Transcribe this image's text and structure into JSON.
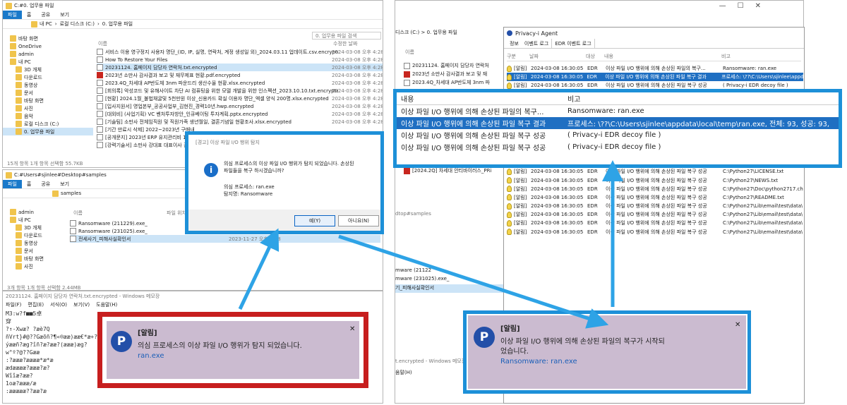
{
  "left_explorer": {
    "titlebar": "C:#0. 업무용 파일",
    "ribbon_tabs": [
      "파일",
      "홈",
      "공유",
      "보기"
    ],
    "address": [
      "내 PC",
      "로컬 디스크 (C:)",
      "0. 업무용 파일"
    ],
    "search_placeholder": "0. 업무용 파일 검색",
    "col_name": "이름",
    "col_date": "수정한 날짜",
    "nav": [
      "바탕 화면",
      "OneDrive",
      "admin",
      "내 PC",
      "3D 개체",
      "다운로드",
      "동영상",
      "문서",
      "바탕 화면",
      "사진",
      "음악",
      "로컬 디스크 (C:)",
      "0. 업무용 파일"
    ],
    "files": [
      {
        "name": "서비스 이용 영구정지 사용자 명단_(ID, IP, 실명, 연락처, 계정 생성일 외)_2024.03.11 업데이트.csv.encrypted",
        "date": "2024-03-08 오후 4:28"
      },
      {
        "name": "How To Restore Your Files",
        "date": "2024-03-08 오후 4:28"
      },
      {
        "name": "20231124. 홈페이지 담당자 연락처.txt.encrypted",
        "date": "2024-03-08 오후 4:28"
      },
      {
        "name": "2023년 소만사 감사결과 보고 및 재무제표 현황.pdf.encrypted",
        "date": "2024-03-08 오후 4:28"
      },
      {
        "name": "2023.4Q_차세대 AP반도체 3nm 파운드리 생산수율 현황.xlsx.encrypted",
        "date": "2024-03-08 오후 4:28"
      },
      {
        "name": "[회의록] 악성코드 및 유해사이트 차단 AI 컴퓨팅을 위한 모델 개발을 위한 인스펙션_2023.10.10.txt.encrypted",
        "date": "2024-03-08 오후 4:28"
      },
      {
        "name": "[현황] 2024.1월_불법채굴및 5천만원 이상_신용카드 확실 이용자 명단_엑셀 양식 200명.xlsx.encrypted",
        "date": "2024-03-08 오후 4:28"
      },
      {
        "name": "[입사지원서] 영업본부_공공사업부_김현진_경력10년.hwp.encrypted",
        "date": "2024-03-08 오후 4:28"
      },
      {
        "name": "[대외비] (사업기획) VC 벤처투자방안_인큐베이팅 투자계획.pptx.encrypted",
        "date": "2024-03-08 오후 4:28"
      },
      {
        "name": "[기술팀] 소만사 전체임직원 및 직원가족 생년월일, 결혼기념일 현황조사.xlsx.encrypted",
        "date": "2024-03-08 오후 4:28"
      },
      {
        "name": "[기간 만료시 삭제] 2022~2023년 구매내",
        "date": ""
      },
      {
        "name": "[공개문지] 2023년 ERP 유지관리비 1억",
        "date": ""
      },
      {
        "name": "[강력기술서] 소만사 강대표 대표이사 결",
        "date": ""
      }
    ],
    "status": "15개 항목   1개 항목 선택함 55.7KB"
  },
  "left_explorer2": {
    "titlebar": "C:#Users#sjinlee#Desktop#samples",
    "ribbon_tabs": [
      "파일",
      "홈",
      "공유",
      "보기"
    ],
    "address": "samples",
    "col_name": "이름",
    "col_extra": "파일 위치",
    "nav": [
      "admin",
      "내 PC",
      "3D 개체",
      "다운로드",
      "동영상",
      "문서",
      "바탕 화면",
      "사진"
    ],
    "files": [
      {
        "name": "Ransomware (211229).exe_",
        "date": ""
      },
      {
        "name": "Ransomware (231025).exe_",
        "date": ""
      },
      {
        "name": "전세사기_피해사실확인서",
        "date": "2023-11-27 오후 4:28"
      }
    ],
    "status": "3개 항목   1개 항목 선택함 2.44MB"
  },
  "notepad": {
    "title": "20231124. 홈페이지 담당자 연락처.txt.encrypted - Windows 메모장",
    "menu": [
      "파일(F)",
      "편집(E)",
      "서식(O)",
      "보기(V)",
      "도움말(H)"
    ],
    "lines": [
      "M3:w?f■■5卓",
      "穿",
      "?↑-Xwæ?    ?æè7Q",
      "ñVrt}#@??Gæõñ?¶«®ææ)ææ€*æ+?",
      "ýææñ?æg?îñ?æ?ææ?(æææ)æg?",
      "w°º?@??Gææ",
      ":?æææ?ææææ*æ*æ",
      "ædææææ?æææ?æ?",
      "Wîîæ?ææ?",
      "1oæ?æææ/æ",
      ":æææææ??ææ?æ"
    ]
  },
  "dialog": {
    "title": "[경고] 이상 파일 I/O 행위 탐지",
    "message": "의심 프로세스의 이상 파일 I/O 행위가 탐지 되었습니다. 손상된 파일들을 복구 하시겠습니까?",
    "process": "의심 프로세스: ran.exe",
    "detect": "탐지명: Ransomware",
    "yes": "예(Y)",
    "no": "아니요(N)",
    "bg_row": "2023-11-27 오후 4:28"
  },
  "toast_left": {
    "title": "[알림]",
    "line1": "의심 프로세스의 이상 파일 I/O 행위가 탐지 되었습니다.",
    "line2": "ran.exe"
  },
  "toast_right": {
    "title": "[알림]",
    "line1": "이상 파일 I/O 행위에 의해 손상된 파일의 복구가 시작되",
    "line1b": "었습니다.",
    "line2": "Ransomware: ran.exe"
  },
  "right_explorer": {
    "address": "디스크 (C:)  >  0. 업무용 파일",
    "col_name": "이름",
    "files": [
      "20231124. 홈페이지 담당자 연락처",
      "2023년 소만사 감사결과 보고 및 재",
      "2023.4Q_차세대 AP반도체 3nm 파"
    ],
    "bottom_file": "[2024.2Q] 차세대 안티바이러스_PRi",
    "path2": "dtop#samples",
    "samples": [
      "mware (21122",
      "mware (231025).exe_",
      "기_피해사실확인서"
    ],
    "notepad_title": "t.encrypted - Windows 메모장",
    "notepad_menu": "움말(H)"
  },
  "agent": {
    "title": "Privacy-i Agent",
    "tabs": [
      "정보",
      "이벤트 로그",
      "EDR 이벤트 로그"
    ],
    "cols": [
      "구분",
      "날짜",
      "대상",
      "내용",
      "비고"
    ],
    "rows": [
      {
        "kind": "[알림]",
        "date": "2024-03-08 16:30:05",
        "target": "EDR",
        "content": "이상 파일 I/O 행위에 의해 손상된 파일의 복구...",
        "note": "Ransomware: ran.exe"
      },
      {
        "kind": "[알림]",
        "date": "2024-03-08 16:30:05",
        "target": "EDR",
        "content": "이상 파일 I/O 행위에 의해 손상된 파일 복구 결과",
        "note": "프로세스: \\??\\C:\\Users\\sjinlee\\appd"
      },
      {
        "kind": "[알림]",
        "date": "2024-03-08 16:30:05",
        "target": "EDR",
        "content": "이상 파일 I/O 행위에 의해 손상된 파일 복구 성공",
        "note": "( Privacy-i EDR decoy file )"
      },
      {
        "kind": "[알림]",
        "date": "2024-03-08 16:30:05",
        "target": "EDR",
        "content": "이상 파일 I/O 행위에 의해 손상된 파일 복구 성공",
        "note": "( Privacy-i EDR decoy file )"
      },
      {
        "kind": "[알림]",
        "date": "2024-03-08 16:30:05",
        "target": "EDR",
        "content": "이상 파일 I/O 행위에 의해 손상된 파일 복구 성공",
        "note": "C:\\0. 업무용 파일\\[2024.2Q] 차"
      },
      {
        "kind": "[알림]",
        "date": "2024-03-08 16:30:05",
        "target": "EDR",
        "content": "이상 파일 I/O 행위에 의해 손상된 파일 복구 성공",
        "note": "C:\\0. 업무용 파일\\[공개문지] 20"
      },
      {
        "kind": "[알림]",
        "date": "2024-03-08 16:30:05",
        "target": "EDR",
        "content": "이상 파일 I/O 행위에 의해 손상된 파일 복구 성공",
        "note": "C:\\0. 업무용 파일\\[기간 만료시 삭"
      },
      {
        "kind": "[알림]",
        "date": "2024-03-08 16:30:05",
        "target": "EDR",
        "content": "이상 파일 I/O 행위에 의해 손상된 파일 복구 성공",
        "note": "C:\\0. 업무용 파일\\[기술팀] 소만사"
      },
      {
        "kind": "[알림]",
        "date": "2024-03-08 16:30:05",
        "target": "EDR",
        "content": "이상 파일 I/O 행위에 의해 손상된 파일 복구 성공",
        "note": "C:\\0. 업무용 파일\\[대외비] (사업"
      },
      {
        "kind": "[알림]",
        "date": "2024-03-08 16:30:05",
        "target": "EDR",
        "content": "이상 파일 I/O 행위에 의해 손상된 파일 복구 성공",
        "note": "C:\\0. 업무용 파일\\[입사지원서] 영"
      },
      {
        "kind": "[알림]",
        "date": "2024-03-08 16:30:05",
        "target": "EDR",
        "content": "이상 파일 I/O 행위에 의해 손상된 파일 복구 성공",
        "note": "C:\\0. 업무용 파일\\[현황] 2024.1"
      },
      {
        "kind": "[알림]",
        "date": "2024-03-08 16:30:05",
        "target": "EDR",
        "content": "이상 파일 I/O 행위에 의해 손상된 파일 복구 성공",
        "note": "C:\\0. 업무용 파일\\[회의록] 악성코"
      },
      {
        "kind": "[알림]",
        "date": "2024-03-08 16:30:05",
        "target": "EDR",
        "content": "이상 파일 I/O 행위에 의해 손상된 파일 복구 성공",
        "note": "C:\\Python27\\LICENSE.txt"
      },
      {
        "kind": "[알림]",
        "date": "2024-03-08 16:30:05",
        "target": "EDR",
        "content": "이상 파일 I/O 행위에 의해 손상된 파일 복구 성공",
        "note": "C:\\Python27\\NEWS.txt"
      },
      {
        "kind": "[알림]",
        "date": "2024-03-08 16:30:05",
        "target": "EDR",
        "content": "이상 파일 I/O 행위에 의해 손상된 파일 복구 성공",
        "note": "C:\\Python27\\Doc\\python2717.ch"
      },
      {
        "kind": "[알림]",
        "date": "2024-03-08 16:30:05",
        "target": "EDR",
        "content": "이상 파일 I/O 행위에 의해 손상된 파일 복구 성공",
        "note": "C:\\Python27\\README.txt"
      },
      {
        "kind": "[알림]",
        "date": "2024-03-08 16:30:05",
        "target": "EDR",
        "content": "이상 파일 I/O 행위에 의해 손상된 파일 복구 성공",
        "note": "C:\\Python27\\Lib\\email\\test\\data\\"
      },
      {
        "kind": "[알림]",
        "date": "2024-03-08 16:30:05",
        "target": "EDR",
        "content": "이상 파일 I/O 행위에 의해 손상된 파일 복구 성공",
        "note": "C:\\Python27\\Lib\\email\\test\\data\\"
      },
      {
        "kind": "[알림]",
        "date": "2024-03-08 16:30:05",
        "target": "EDR",
        "content": "이상 파일 I/O 행위에 의해 손상된 파일 복구 성공",
        "note": "C:\\Python27\\Lib\\email\\test\\data\\"
      },
      {
        "kind": "[알림]",
        "date": "2024-03-08 16:30:05",
        "target": "EDR",
        "content": "이상 파일 I/O 행위에 의해 손상된 파일 복구 성공",
        "note": "C:\\Python27\\Lib\\email\\test\\data\\"
      }
    ]
  },
  "zoom": {
    "col_content": "내용",
    "col_note": "비고",
    "rows": [
      {
        "content": "이상 파일 I/O 행위에 의해 손상된 파일의 복구...",
        "note": "Ransomware: ran.exe"
      },
      {
        "content": "이상 파일 I/O 행위에 의해 손상된 파일 복구 결과",
        "note": "프로세스: \\??\\C:\\Users\\sjinlee\\appdata\\local\\temp\\ran.exe, 전체: 93, 성공: 93,"
      },
      {
        "content": "이상 파일 I/O 행위에 의해 손상된 파일 복구 성공",
        "note": "( Privacy-i EDR decoy file )"
      },
      {
        "content": "이상 파일 I/O 행위에 의해 손상된 파일 복구 성공",
        "note": "( Privacy-i EDR decoy file )"
      }
    ]
  },
  "colors": {
    "frame_blue": "#1d90d8",
    "frame_red": "#c71e1e",
    "toast_bg": "#cbbbd0",
    "logo": "#234fa8",
    "select": "#1f6fc2"
  }
}
